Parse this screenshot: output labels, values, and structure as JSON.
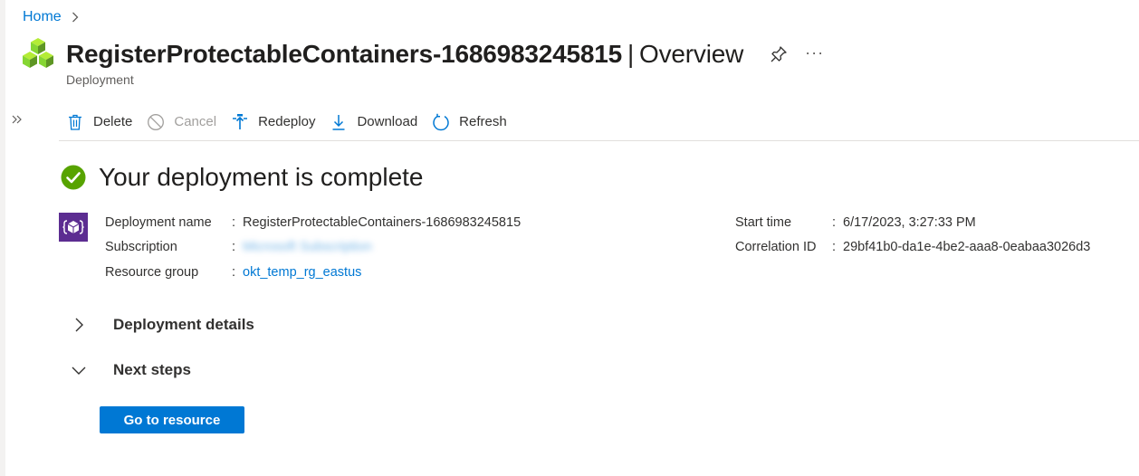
{
  "breadcrumb": {
    "home": "Home"
  },
  "header": {
    "title": "RegisterProtectableContainers-1686983245815",
    "separator": "|",
    "section": "Overview",
    "subtitle": "Deployment",
    "more": "···"
  },
  "toolbar": {
    "delete": "Delete",
    "cancel": "Cancel",
    "redeploy": "Redeploy",
    "download": "Download",
    "refresh": "Refresh"
  },
  "status": {
    "message": "Your deployment is complete"
  },
  "details": {
    "deployment_name_label": "Deployment name",
    "deployment_name": "RegisterProtectableContainers-1686983245815",
    "subscription_label": "Subscription",
    "subscription": "Microsoft Subscription",
    "resource_group_label": "Resource group",
    "resource_group": "okt_temp_rg_eastus",
    "start_time_label": "Start time",
    "start_time": "6/17/2023, 3:27:33 PM",
    "correlation_id_label": "Correlation ID",
    "correlation_id": "29bf41b0-da1e-4be2-aaa8-0eabaa3026d3",
    "colon": ":"
  },
  "sections": {
    "deployment_details": "Deployment details",
    "next_steps": "Next steps"
  },
  "actions": {
    "go_to_resource": "Go to resource"
  },
  "colors": {
    "accent": "#0078d4",
    "success": "#57a300",
    "resource_icon": "#7fba00",
    "deployment_icon": "#5c2d91"
  },
  "icons": {
    "home_chevron": "chevron-right-icon",
    "resource": "cubes-icon",
    "pin": "pin-icon",
    "expand": "double-chevron-right-icon",
    "delete": "trash-icon",
    "cancel": "cancel-icon",
    "redeploy": "redeploy-icon",
    "download": "download-icon",
    "refresh": "refresh-icon",
    "status": "check-circle-icon",
    "deployment": "deployment-icon"
  }
}
